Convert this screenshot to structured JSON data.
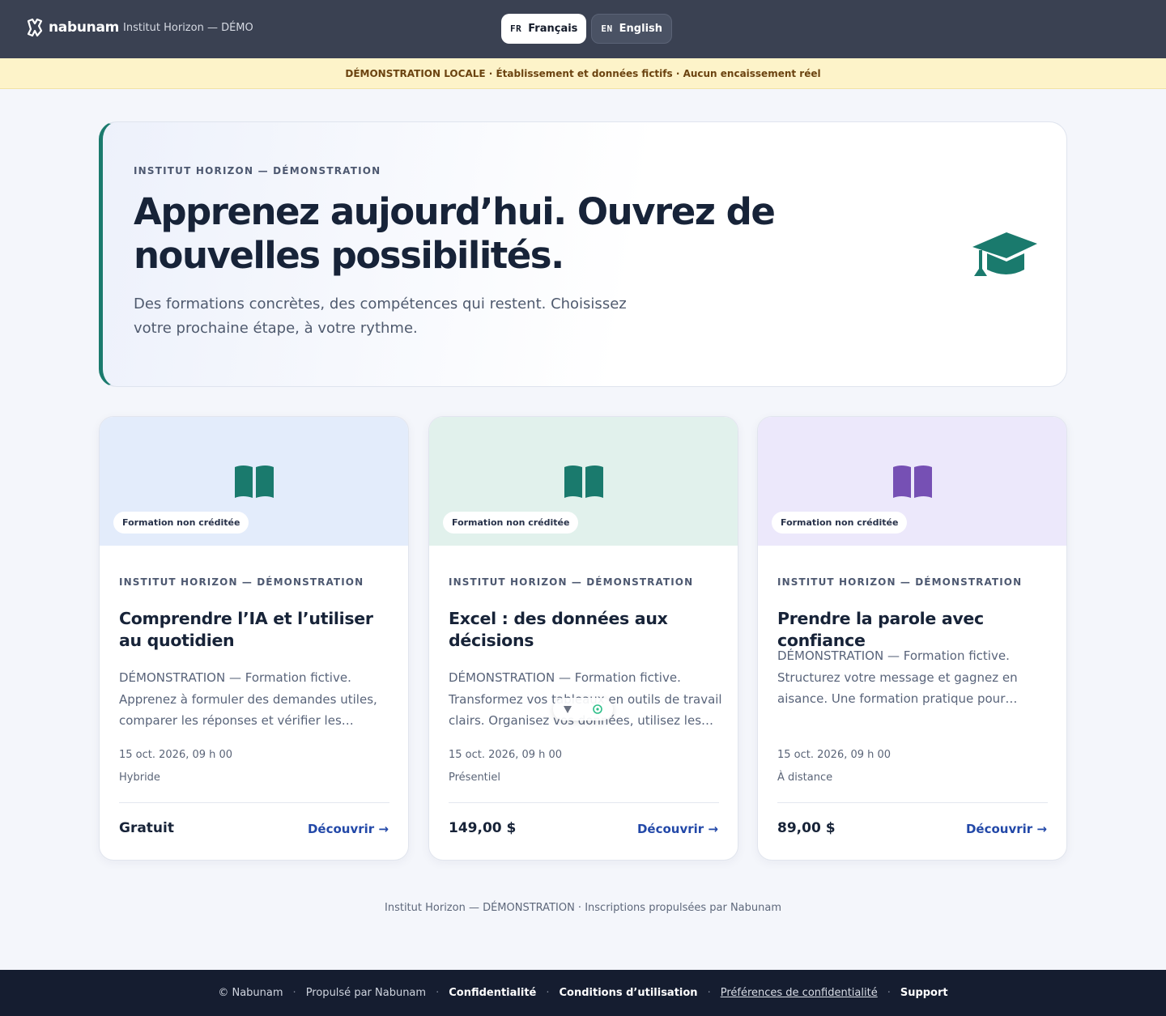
{
  "header": {
    "brand": "nabunam",
    "org": "Institut Horizon — DÉMO",
    "languages": [
      {
        "code": "FR",
        "label": "Français",
        "active": true
      },
      {
        "code": "EN",
        "label": "English",
        "active": false
      }
    ]
  },
  "banner": "DÉMONSTRATION LOCALE · Établissement et données fictifs · Aucun encaissement réel",
  "hero": {
    "eyebrow": "INSTITUT HORIZON — DÉMONSTRATION",
    "title": "Apprenez aujourd’hui. Ouvrez de nouvelles possibilités.",
    "subtitle": "Des formations concrètes, des compétences qui restent. Choisissez votre prochaine étape, à votre rythme.",
    "icon": "graduation-cap-icon"
  },
  "courses": [
    {
      "badge": "Formation non créditée",
      "eyebrow": "INSTITUT HORIZON — DÉMONSTRATION",
      "title": "Comprendre l’IA et l’utiliser au quotidien",
      "description": "DÉMONSTRATION — Formation fictive. Apprenez à formuler des demandes utiles, comparer les réponses et vérifier les…",
      "date": "15 oct. 2026, 09 h 00",
      "mode": "Hybride",
      "price": "Gratuit",
      "cta": "Découvrir →",
      "media_bg": "#e3ecfb",
      "icon_color": "#1a7a6d"
    },
    {
      "badge": "Formation non créditée",
      "eyebrow": "INSTITUT HORIZON — DÉMONSTRATION",
      "title": "Excel : des données aux décisions",
      "description": "DÉMONSTRATION — Formation fictive. Transformez vos tableaux en outils de travail clairs. Organisez vos données, utilisez les…",
      "date": "15 oct. 2026, 09 h 00",
      "mode": "Présentiel",
      "price": "149,00 $",
      "cta": "Découvrir →",
      "media_bg": "#e1f1ec",
      "icon_color": "#1a7a6d"
    },
    {
      "badge": "Formation non créditée",
      "eyebrow": "INSTITUT HORIZON — DÉMONSTRATION",
      "title": "Prendre la parole avec confiance",
      "description": "DÉMONSTRATION — Formation fictive. Structurez votre message et gagnez en aisance. Une formation pratique pour…",
      "date": "15 oct. 2026, 09 h 00",
      "mode": "À distance",
      "price": "89,00 $",
      "cta": "Découvrir →",
      "media_bg": "#ece8fb",
      "icon_color": "#7650b4"
    }
  ],
  "footer_note": "Institut Horizon — DÉMONSTRATION · Inscriptions propulsées par Nabunam",
  "bottombar": {
    "copyright": "© Nabunam",
    "powered": "Propulsé par Nabunam",
    "privacy": "Confidentialité",
    "terms": "Conditions d’utilisation",
    "preferences": "Préférences de confidentialité",
    "support": "Support"
  }
}
